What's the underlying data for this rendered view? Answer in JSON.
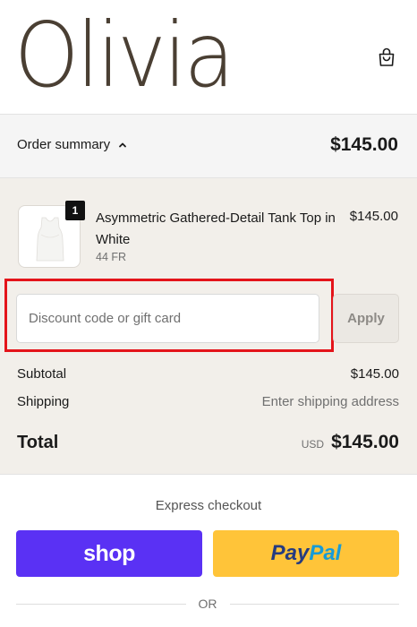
{
  "brand": {
    "logo_text": "Olivia"
  },
  "header": {
    "cart_icon": "shopping-bag-icon"
  },
  "summary": {
    "toggle_label": "Order summary",
    "toggle_icon": "chevron-up-icon",
    "total": "$145.00"
  },
  "line_item": {
    "quantity": "1",
    "name": "Asymmetric Gathered-Detail Tank Top in White",
    "variant": "44 FR",
    "price": "$145.00",
    "thumbnail_icon": "tank-top-image"
  },
  "discount": {
    "placeholder": "Discount code or gift card",
    "apply_label": "Apply"
  },
  "totals": {
    "subtotal_label": "Subtotal",
    "subtotal_value": "$145.00",
    "shipping_label": "Shipping",
    "shipping_value": "Enter shipping address",
    "total_label": "Total",
    "currency": "USD",
    "total_value": "$145.00"
  },
  "express": {
    "heading": "Express checkout",
    "shop_label": "shop",
    "paypal_part1": "Pay",
    "paypal_part2": "Pal",
    "divider_text": "OR"
  },
  "colors": {
    "shop_purple": "#5a31f4",
    "paypal_yellow": "#ffc439",
    "highlight_red": "#e4141a",
    "logo_brown": "#4a3f33"
  }
}
